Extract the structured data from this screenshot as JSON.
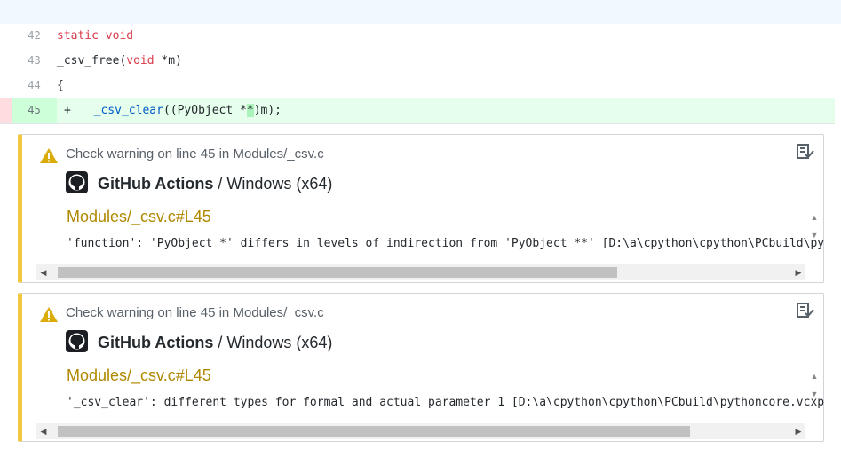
{
  "diff": {
    "lines": [
      {
        "num": "42",
        "code": "static void"
      },
      {
        "num": "43",
        "code": "_csv_free(void *m)"
      },
      {
        "num": "44",
        "code": "{"
      },
      {
        "num": "45",
        "sign": "+",
        "code": "    _csv_clear((PyObject **)m);"
      }
    ]
  },
  "annotations": [
    {
      "title": "Check warning on line 45 in Modules/_csv.c",
      "source_bold": "GitHub Actions",
      "source_rest": " / Windows (x64)",
      "link": "Modules/_csv.c#L45",
      "message": "'function': 'PyObject *' differs in levels of indirection from 'PyObject **' [D:\\a\\cpython\\cpython\\PCbuild\\pythoncore.vcxproj]",
      "hscroll_fraction": 0.77
    },
    {
      "title": "Check warning on line 45 in Modules/_csv.c",
      "source_bold": "GitHub Actions",
      "source_rest": " / Windows (x64)",
      "link": "Modules/_csv.c#L45",
      "message": "'_csv_clear': different types for formal and actual parameter 1 [D:\\a\\cpython\\cpython\\PCbuild\\pythoncore.vcxproj]",
      "hscroll_fraction": 0.87
    }
  ],
  "colors": {
    "warning": "#f0c940",
    "link": "#b08800",
    "added_bg": "#e6ffed"
  }
}
